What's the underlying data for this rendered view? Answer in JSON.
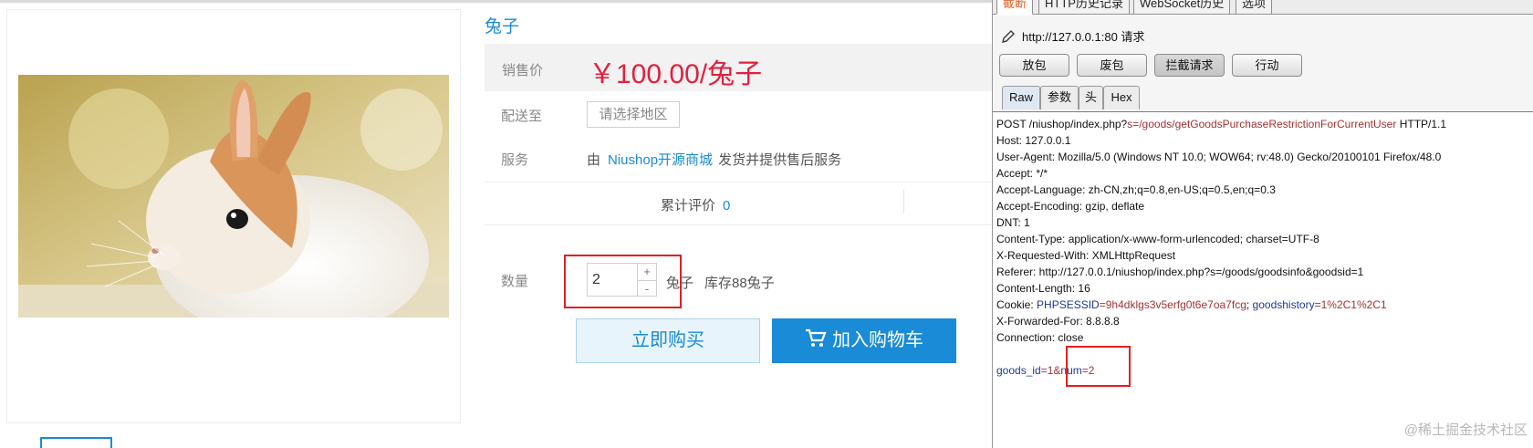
{
  "product": {
    "title": "兔子",
    "price_label": "销售价",
    "price": "￥100.00",
    "price_unit": "/兔子",
    "ship_label": "配送至",
    "region_placeholder": "请选择地区",
    "service_label": "服务",
    "service_prefix": "由",
    "service_shop": "Niushop开源商城",
    "service_suffix": "发货并提供售后服务",
    "review_label": "累计评价",
    "review_count": "0",
    "qty_label": "数量",
    "qty_value": "2",
    "qty_plus": "+",
    "qty_minus": "-",
    "qty_unit": "兔子",
    "stock": "库存88兔子",
    "buy_now": "立即购买",
    "add_cart": "加入购物车"
  },
  "burp": {
    "top_tabs": [
      "截断",
      "HTTP历史记录",
      "WebSocket历史",
      "选项"
    ],
    "url": "http://127.0.0.1:80 请求",
    "action_buttons": [
      "放包",
      "废包",
      "拦截请求",
      "行动"
    ],
    "editor_tabs": [
      "Raw",
      "参数",
      "头",
      "Hex"
    ],
    "request": {
      "request_line_method_path": "POST /niushop/index.php?",
      "request_line_param_key": "s",
      "request_line_param_val": "=/goods/getGoodsPurchaseRestrictionForCurrentUser",
      "request_line_version": " HTTP/1.1",
      "host": "Host: 127.0.0.1",
      "user_agent": "User-Agent: Mozilla/5.0 (Windows NT 10.0; WOW64; rv:48.0) Gecko/20100101 Firefox/48.0",
      "accept": "Accept: */*",
      "accept_language": "Accept-Language: zh-CN,zh;q=0.8,en-US;q=0.5,en;q=0.3",
      "accept_encoding": "Accept-Encoding: gzip, deflate",
      "dnt": "DNT: 1",
      "content_type": "Content-Type: application/x-www-form-urlencoded; charset=UTF-8",
      "x_requested_with": "X-Requested-With: XMLHttpRequest",
      "referer": "Referer: http://127.0.0.1/niushop/index.php?s=/goods/goodsinfo&goodsid=1",
      "content_length": "Content-Length: 16",
      "cookie_prefix": "Cookie: ",
      "cookie_k1": "PHPSESSID",
      "cookie_v1": "=9h4dklgs3v5erfg0t6e7oa7fcg",
      "cookie_sep": "; ",
      "cookie_k2": "goodshistory",
      "cookie_v2": "=1%2C1%2C1",
      "x_forwarded_for": "X-Forwarded-For: 8.8.8.8",
      "connection": "Connection: close",
      "body_k1": "goods_id",
      "body_v1": "=1&",
      "body_k2": "num",
      "body_v2": "=2"
    }
  },
  "watermark": "@稀土掘金技术社区",
  "colors": {
    "accent_blue": "#1a8bd6",
    "price_red": "#e3203e",
    "highlight_red": "#e02020",
    "burp_orange": "#e8642c"
  }
}
